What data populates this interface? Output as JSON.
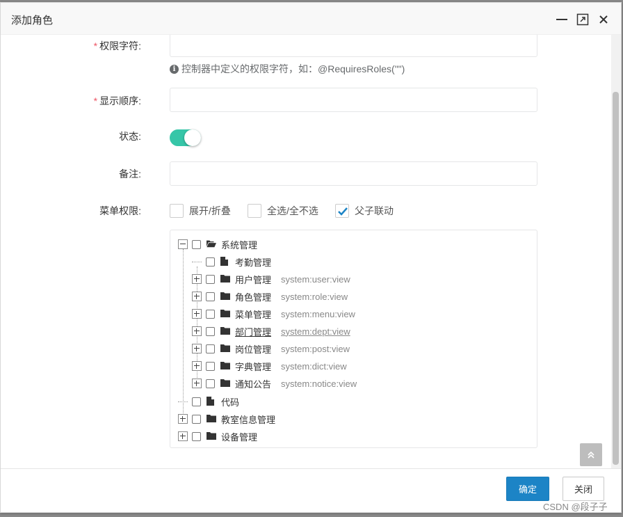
{
  "dialog": {
    "title": "添加角色",
    "controls": {
      "minimize_icon": "minimize-icon",
      "maximize_icon": "maximize-icon",
      "close_icon": "close-icon"
    }
  },
  "form": {
    "perm_key": {
      "required_mark": "*",
      "label": "权限字符:",
      "value": "",
      "help_icon": "info-icon",
      "help": "控制器中定义的权限字符，如：@RequiresRoles(\"\")"
    },
    "sort_order": {
      "required_mark": "*",
      "label": "显示顺序:",
      "value": ""
    },
    "status": {
      "label": "状态:",
      "enabled": true
    },
    "remark": {
      "label": "备注:",
      "value": ""
    },
    "menu": {
      "label": "菜单权限:",
      "options": [
        {
          "label": "展开/折叠",
          "checked": false
        },
        {
          "label": "全选/全不选",
          "checked": false
        },
        {
          "label": "父子联动",
          "checked": true
        }
      ]
    }
  },
  "tree": {
    "nodes": [
      {
        "name": "系统管理",
        "perm": "",
        "switch": "minus",
        "icon": "folder-open-icon"
      },
      {
        "name": "考勤管理",
        "perm": "",
        "switch": "none",
        "icon": "file-icon"
      },
      {
        "name": "用户管理",
        "perm": "system:user:view",
        "switch": "plus",
        "icon": "folder-icon"
      },
      {
        "name": "角色管理",
        "perm": "system:role:view",
        "switch": "plus",
        "icon": "folder-icon"
      },
      {
        "name": "菜单管理",
        "perm": "system:menu:view",
        "switch": "plus",
        "icon": "folder-icon"
      },
      {
        "name": "部门管理",
        "perm": "system:dept:view",
        "switch": "plus",
        "icon": "folder-icon",
        "hovered": true
      },
      {
        "name": "岗位管理",
        "perm": "system:post:view",
        "switch": "plus",
        "icon": "folder-icon"
      },
      {
        "name": "字典管理",
        "perm": "system:dict:view",
        "switch": "plus",
        "icon": "folder-icon"
      },
      {
        "name": "通知公告",
        "perm": "system:notice:view",
        "switch": "plus",
        "icon": "folder-icon"
      },
      {
        "name": "代码",
        "perm": "",
        "switch": "none",
        "icon": "file-icon"
      },
      {
        "name": "教室信息管理",
        "perm": "",
        "switch": "plus",
        "icon": "folder-icon"
      },
      {
        "name": "设备管理",
        "perm": "",
        "switch": "plus",
        "icon": "folder-icon"
      }
    ]
  },
  "footer": {
    "confirm": "确定",
    "close": "关闭"
  },
  "back_to_top_icon": "double-chevron-up-icon",
  "watermark": "CSDN @段子子",
  "colors": {
    "primary": "#1c84c6",
    "toggle_on": "#36c6a8",
    "required": "#ed5565"
  }
}
